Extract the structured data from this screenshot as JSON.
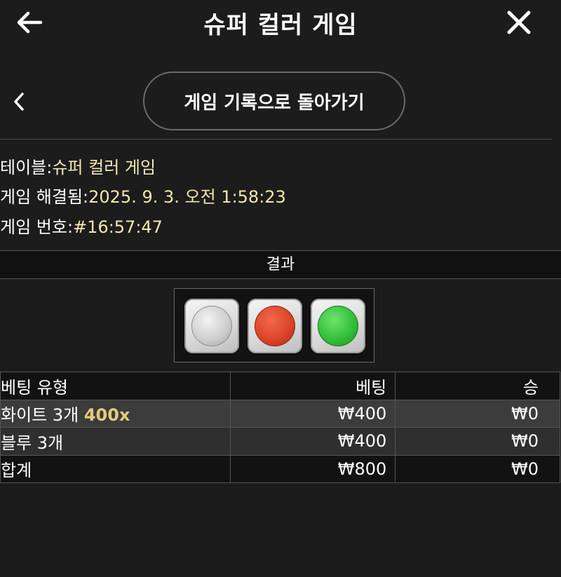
{
  "header": {
    "title": "슈퍼 컬러 게임",
    "back_icon": "left-arrow-icon",
    "close_icon": "close-icon"
  },
  "subnav": {
    "back_icon": "chevron-left-icon",
    "history_button": "게임 기록으로 돌아가기"
  },
  "info": {
    "table_label": "테이블:",
    "table_value": "슈퍼 컬러 게임",
    "resolved_label": "게임 해결됨:",
    "resolved_value": "2025. 9. 3. 오전 1:58:23",
    "number_label": "게임 번호:",
    "number_value": "#16:57:47"
  },
  "result": {
    "heading": "결과",
    "dice": [
      {
        "name": "white-die",
        "color": "#e6e6e6"
      },
      {
        "name": "red-die",
        "color": "#e2472a"
      },
      {
        "name": "green-die",
        "color": "#35c23c"
      }
    ]
  },
  "bets": {
    "headers": [
      "베팅 유형",
      "베팅",
      "승"
    ],
    "rows": [
      {
        "type": "화이트 3개",
        "multiplier": "400x",
        "bet": "₩400",
        "win": "₩0"
      },
      {
        "type": "블루 3개",
        "multiplier": "",
        "bet": "₩400",
        "win": "₩0"
      },
      {
        "type": "합계",
        "multiplier": "",
        "bet": "₩800",
        "win": "₩0"
      }
    ]
  },
  "colors": {
    "background": "#1c1c1c",
    "value_text": "#f4e7b0",
    "multiplier": "#e3cc7a"
  }
}
